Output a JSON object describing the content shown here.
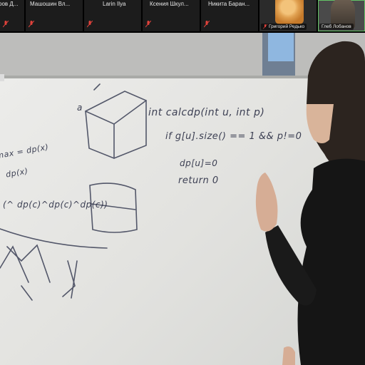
{
  "participants": [
    {
      "name": "ров Д..."
    },
    {
      "name": "Машошин Вл..."
    },
    {
      "name": "Larin Ilya"
    },
    {
      "name": "Ксения Шкул..."
    },
    {
      "name": "Никита Баран..."
    },
    {
      "name": "Григорий Редько"
    },
    {
      "name": "Глеб Лобанов"
    }
  ],
  "whiteboard": {
    "code_line_1": "int calcdp(int u, int p)",
    "code_line_2": "if g[u].size() == 1 && p!=0",
    "code_line_3": "dp[u]=0",
    "code_line_4": "return 0",
    "note_left_1": "max = dp(x)",
    "note_left_2": "dp(x)",
    "formula": "(^ dp(c)^dp(c)^dp(c))",
    "cube_label": "a"
  },
  "colors": {
    "active_speaker_border": "#63c466",
    "muted_icon": "#e0423b",
    "ink": "#2a2e44"
  }
}
